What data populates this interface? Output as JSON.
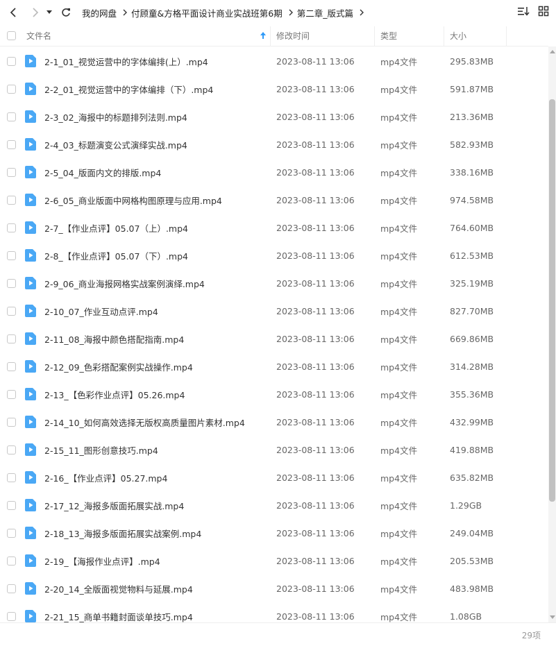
{
  "breadcrumb": [
    "我的网盘",
    "付顾童&方格平面设计商业实战班第6期",
    "第二章_版式篇"
  ],
  "columns": {
    "name": "文件名",
    "modified": "修改时间",
    "type": "类型",
    "size": "大小"
  },
  "files": [
    {
      "name": "2-1_01_视觉运营中的字体编排(上）.mp4",
      "modified": "2023-08-11 13:06",
      "type": "mp4文件",
      "size": "295.83MB"
    },
    {
      "name": "2-2_01_视觉运营中的字体编排（下）.mp4",
      "modified": "2023-08-11 13:06",
      "type": "mp4文件",
      "size": "591.87MB"
    },
    {
      "name": "2-3_02_海报中的标题排列法则.mp4",
      "modified": "2023-08-11 13:06",
      "type": "mp4文件",
      "size": "213.36MB"
    },
    {
      "name": "2-4_03_标题演变公式演绎实战.mp4",
      "modified": "2023-08-11 13:06",
      "type": "mp4文件",
      "size": "582.93MB"
    },
    {
      "name": "2-5_04_版面内文的排版.mp4",
      "modified": "2023-08-11 13:06",
      "type": "mp4文件",
      "size": "338.16MB"
    },
    {
      "name": "2-6_05_商业版面中网格构图原理与应用.mp4",
      "modified": "2023-08-11 13:06",
      "type": "mp4文件",
      "size": "974.58MB"
    },
    {
      "name": "2-7_【作业点评】05.07（上）.mp4",
      "modified": "2023-08-11 13:06",
      "type": "mp4文件",
      "size": "764.60MB"
    },
    {
      "name": "2-8_【作业点评】05.07（下）.mp4",
      "modified": "2023-08-11 13:06",
      "type": "mp4文件",
      "size": "612.53MB"
    },
    {
      "name": "2-9_06_商业海报网格实战案例演绎.mp4",
      "modified": "2023-08-11 13:06",
      "type": "mp4文件",
      "size": "325.19MB"
    },
    {
      "name": "2-10_07_作业互动点评.mp4",
      "modified": "2023-08-11 13:06",
      "type": "mp4文件",
      "size": "827.70MB"
    },
    {
      "name": "2-11_08_海报中颜色搭配指南.mp4",
      "modified": "2023-08-11 13:06",
      "type": "mp4文件",
      "size": "669.86MB"
    },
    {
      "name": "2-12_09_色彩搭配案例实战操作.mp4",
      "modified": "2023-08-11 13:06",
      "type": "mp4文件",
      "size": "314.28MB"
    },
    {
      "name": "2-13_【色彩作业点评】05.26.mp4",
      "modified": "2023-08-11 13:06",
      "type": "mp4文件",
      "size": "355.36MB"
    },
    {
      "name": "2-14_10_如何高效选择无版权高质量图片素材.mp4",
      "modified": "2023-08-11 13:06",
      "type": "mp4文件",
      "size": "432.99MB"
    },
    {
      "name": "2-15_11_图形创意技巧.mp4",
      "modified": "2023-08-11 13:06",
      "type": "mp4文件",
      "size": "419.88MB"
    },
    {
      "name": "2-16_【作业点评】05.27.mp4",
      "modified": "2023-08-11 13:06",
      "type": "mp4文件",
      "size": "635.82MB"
    },
    {
      "name": "2-17_12_海报多版面拓展实战.mp4",
      "modified": "2023-08-11 13:06",
      "type": "mp4文件",
      "size": "1.29GB"
    },
    {
      "name": "2-18_13_海报多版面拓展实战案例.mp4",
      "modified": "2023-08-11 13:06",
      "type": "mp4文件",
      "size": "249.04MB"
    },
    {
      "name": "2-19_【海报作业点评】.mp4",
      "modified": "2023-08-11 13:06",
      "type": "mp4文件",
      "size": "205.53MB"
    },
    {
      "name": "2-20_14_全版面视觉物料与延展.mp4",
      "modified": "2023-08-11 13:06",
      "type": "mp4文件",
      "size": "483.98MB"
    },
    {
      "name": "2-21_15_商单书籍封面谈单技巧.mp4",
      "modified": "2023-08-11 13:06",
      "type": "mp4文件",
      "size": "1.08GB"
    }
  ],
  "footer": {
    "count": "29项"
  },
  "icons": {
    "back": "arrow-left-icon",
    "forward": "arrow-right-icon",
    "history": "caret-down-icon",
    "refresh": "refresh-icon",
    "sort": "sort-asc-icon",
    "sort_view": "sort-list-icon",
    "grid_view": "grid-view-icon",
    "file": "video-file-icon"
  },
  "colors": {
    "accent": "#2f9af8",
    "file_icon": "#4aa8f5"
  }
}
